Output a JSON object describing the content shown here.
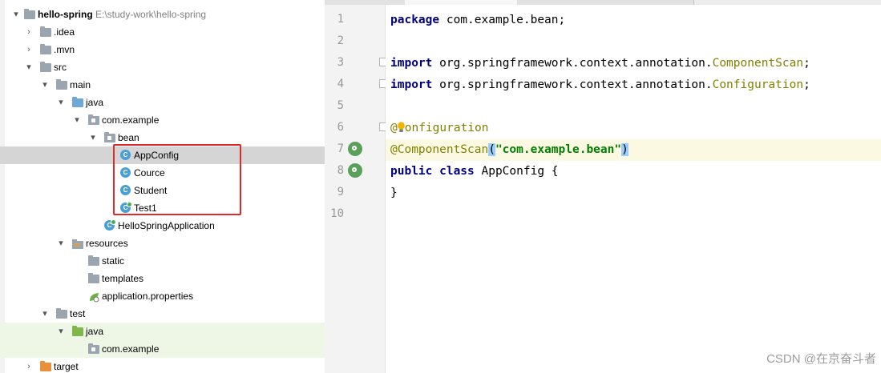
{
  "tree": {
    "rows": [
      {
        "label": "hello-spring",
        "path": "E:\\study-work\\hello-spring",
        "arrow": "▾",
        "icon": "module-folder-icon"
      },
      {
        "label": ".idea",
        "arrow": "›",
        "icon": "folder-icon"
      },
      {
        "label": ".mvn",
        "arrow": "›",
        "icon": "folder-icon"
      },
      {
        "label": "src",
        "arrow": "▾",
        "icon": "folder-icon"
      },
      {
        "label": "main",
        "arrow": "▾",
        "icon": "folder-icon"
      },
      {
        "label": "java",
        "arrow": "▾",
        "icon": "source-folder-icon"
      },
      {
        "label": "com.example",
        "arrow": "▾",
        "icon": "package-icon"
      },
      {
        "label": "bean",
        "arrow": "▾",
        "icon": "package-icon"
      },
      {
        "label": "AppConfig",
        "icon": "class-icon",
        "class_letter": "C"
      },
      {
        "label": "Cource",
        "icon": "class-icon",
        "class_letter": "C"
      },
      {
        "label": "Student",
        "icon": "class-icon",
        "class_letter": "C"
      },
      {
        "label": "Test1",
        "icon": "runnable-class-icon",
        "class_letter": "C"
      },
      {
        "label": "HelloSpringApplication",
        "icon": "spring-boot-class-icon",
        "class_letter": "C"
      },
      {
        "label": "resources",
        "arrow": "▾",
        "icon": "resources-folder-icon"
      },
      {
        "label": "static",
        "icon": "folder-icon"
      },
      {
        "label": "templates",
        "icon": "folder-icon"
      },
      {
        "label": "application.properties",
        "icon": "spring-properties-icon"
      },
      {
        "label": "test",
        "arrow": "▾",
        "icon": "folder-icon"
      },
      {
        "label": "java",
        "arrow": "▾",
        "icon": "test-source-folder-icon"
      },
      {
        "label": "com.example",
        "icon": "package-icon"
      },
      {
        "label": "target",
        "arrow": "›",
        "icon": "excluded-folder-icon"
      }
    ]
  },
  "editor": {
    "line_numbers": [
      "1",
      "2",
      "3",
      "4",
      "5",
      "6",
      "7",
      "8",
      "9",
      "10"
    ],
    "code": {
      "l1_kw": "package",
      "l1_rest": " com.example.bean;",
      "l3_kw": "import",
      "l3_pkg": " org.springframework.context.annotation.",
      "l3_cls": "ComponentScan",
      "l3_end": ";",
      "l4_kw": "import",
      "l4_pkg": " org.springframework.context.annotation.",
      "l4_cls": "Configuration",
      "l4_end": ";",
      "l6_ann_at": "@",
      "l6_ann_rest": "onfiguration",
      "l7_ann": "@ComponentScan",
      "l7_open": "(",
      "l7_str": "\"com.example.bean\"",
      "l7_close": ")",
      "l8_kw": "public class",
      "l8_name": " AppConfig ",
      "l8_brace": "{",
      "l9_brace": "}"
    }
  },
  "colors": {
    "keyword": "#000080",
    "annotation": "#808000",
    "string": "#008000",
    "highlight_box": "#e02a2a",
    "selected_row": "#d5d5d5",
    "current_line": "#fcf9e3"
  },
  "watermark": "CSDN @在京奋斗者"
}
